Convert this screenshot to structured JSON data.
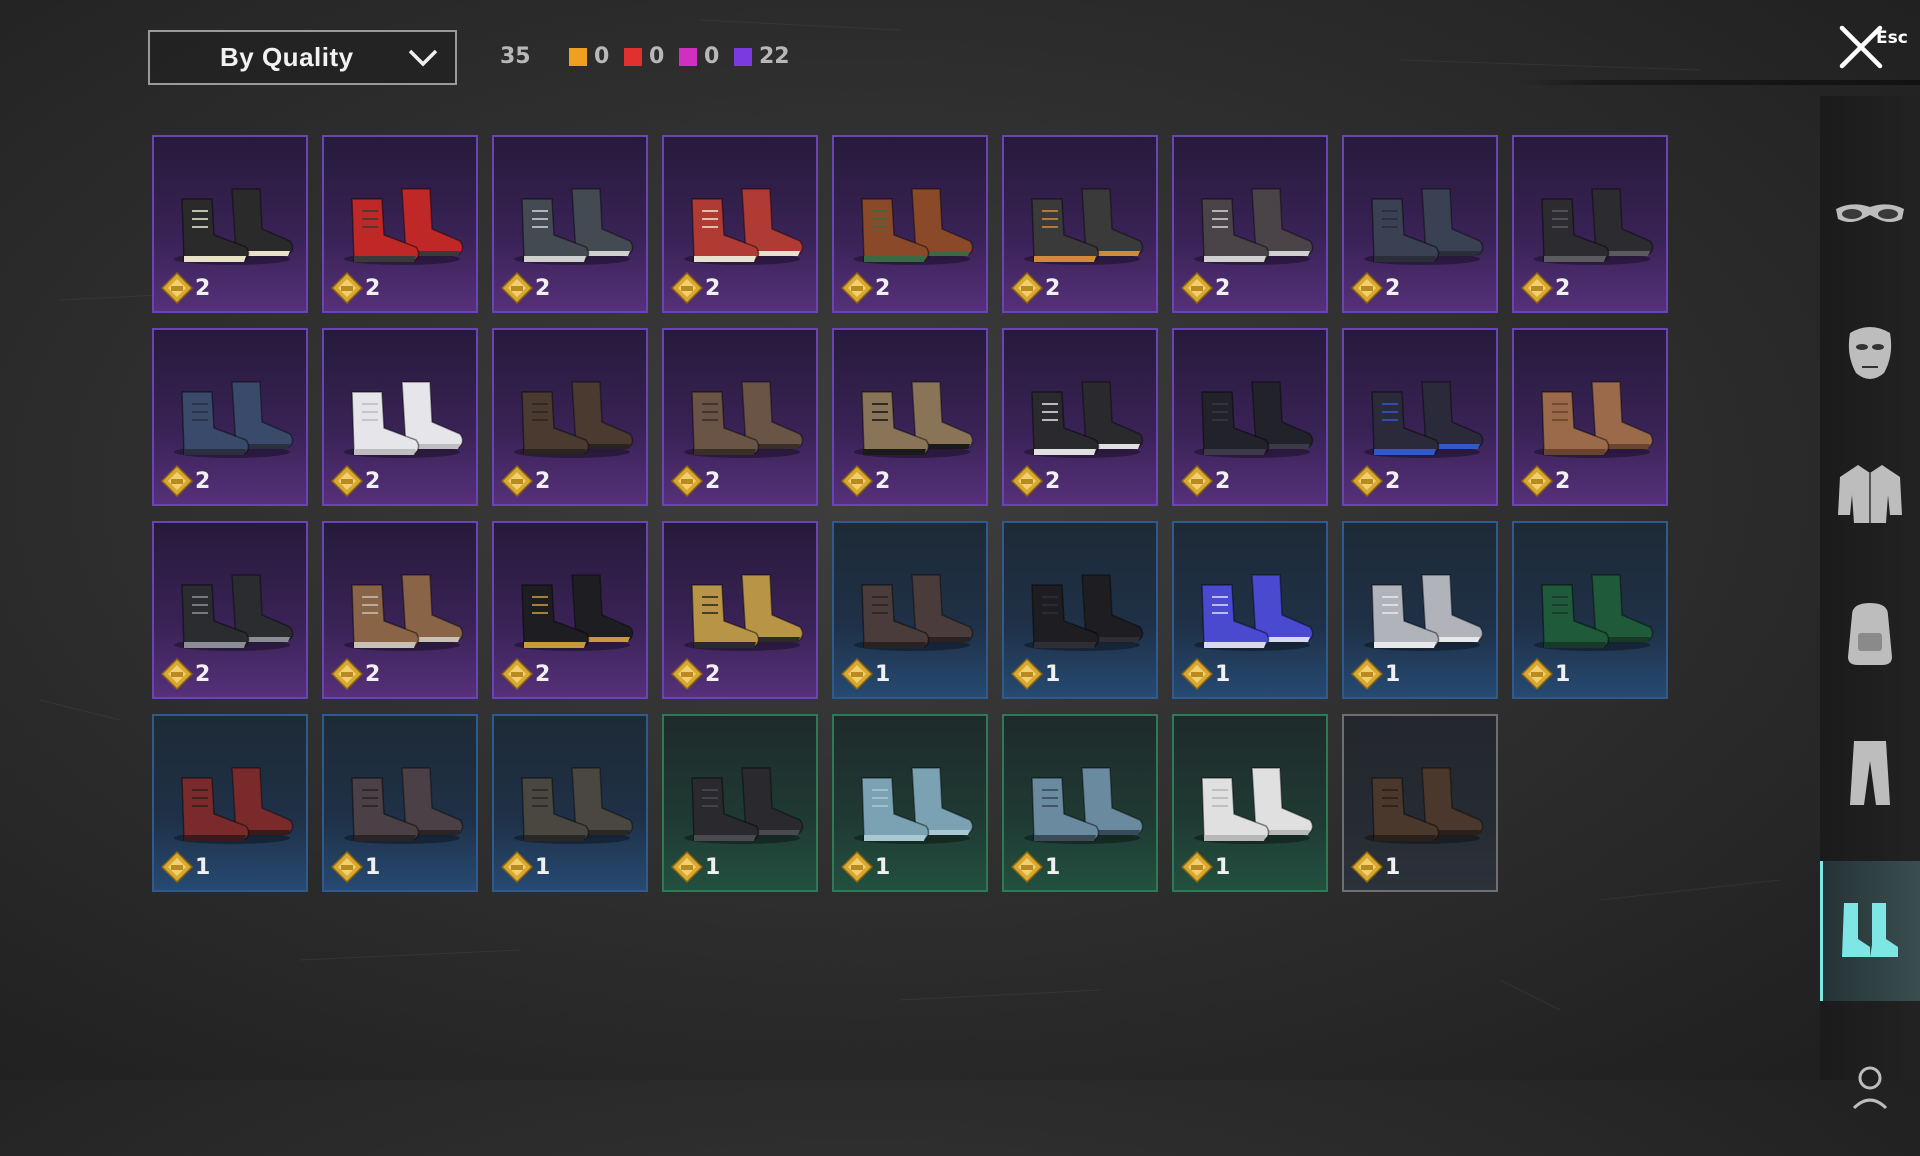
{
  "toolbar": {
    "sort_label": "By Quality",
    "total_count": "35",
    "quality_counts": [
      {
        "color": "#f0a020",
        "count": "0"
      },
      {
        "color": "#e03030",
        "count": "0"
      },
      {
        "color": "#d030c0",
        "count": "0"
      },
      {
        "color": "#7a3ae0",
        "count": "22"
      }
    ]
  },
  "close": {
    "label": "Esc"
  },
  "items": [
    {
      "quality": "purple",
      "color": "#2a2a2a",
      "accent": "#e8e0c8",
      "points": "2"
    },
    {
      "quality": "purple",
      "color": "#c02828",
      "accent": "#3a3a3a",
      "points": "2"
    },
    {
      "quality": "purple",
      "color": "#444a52",
      "accent": "#cfcfcf",
      "points": "2"
    },
    {
      "quality": "purple",
      "color": "#b03a34",
      "accent": "#e8e0d0",
      "points": "2"
    },
    {
      "quality": "purple",
      "color": "#8a4a2a",
      "accent": "#3a6a44",
      "points": "2"
    },
    {
      "quality": "purple",
      "color": "#3a3a3a",
      "accent": "#d08a3a",
      "points": "2"
    },
    {
      "quality": "purple",
      "color": "#4a4448",
      "accent": "#d0d0d0",
      "points": "2"
    },
    {
      "quality": "purple",
      "color": "#394152",
      "accent": "#2a2e38",
      "points": "2"
    },
    {
      "quality": "purple",
      "color": "#2c2c30",
      "accent": "#5a5a60",
      "points": "2"
    },
    {
      "quality": "purple",
      "color": "#3a4a6a",
      "accent": "#2a3040",
      "points": "2"
    },
    {
      "quality": "purple",
      "color": "#e6e6ea",
      "accent": "#bdbdc2",
      "points": "2"
    },
    {
      "quality": "purple",
      "color": "#4a3a30",
      "accent": "#2a2420",
      "points": "2"
    },
    {
      "quality": "purple",
      "color": "#6a5446",
      "accent": "#3a2e28",
      "points": "2"
    },
    {
      "quality": "purple",
      "color": "#8a7458",
      "accent": "#1a1a1a",
      "points": "2"
    },
    {
      "quality": "purple",
      "color": "#2a2a2e",
      "accent": "#e0e0e0",
      "points": "2"
    },
    {
      "quality": "purple",
      "color": "#22222a",
      "accent": "#3a3a48",
      "points": "2"
    },
    {
      "quality": "purple",
      "color": "#2a2a3a",
      "accent": "#2f5ac8",
      "points": "2"
    },
    {
      "quality": "purple",
      "color": "#9a6a4a",
      "accent": "#6a4430",
      "points": "2"
    },
    {
      "quality": "purple",
      "color": "#2a2c30",
      "accent": "#8a8e94",
      "points": "2"
    },
    {
      "quality": "purple",
      "color": "#8a6446",
      "accent": "#c8c0b4",
      "points": "2"
    },
    {
      "quality": "purple",
      "color": "#1e1e22",
      "accent": "#c89a3a",
      "points": "2"
    },
    {
      "quality": "purple",
      "color": "#b89446",
      "accent": "#2a2a2a",
      "points": "2"
    },
    {
      "quality": "blue",
      "color": "#4a3c3a",
      "accent": "#2a2222",
      "points": "1"
    },
    {
      "quality": "blue",
      "color": "#1e1e22",
      "accent": "#2e2e34",
      "points": "1"
    },
    {
      "quality": "blue",
      "color": "#4a4ad0",
      "accent": "#d8d8f0",
      "points": "1"
    },
    {
      "quality": "blue",
      "color": "#b0b4ba",
      "accent": "#e8e8ea",
      "points": "1"
    },
    {
      "quality": "blue",
      "color": "#1f5a3a",
      "accent": "#173a28",
      "points": "1"
    },
    {
      "quality": "blue",
      "color": "#7a2a2a",
      "accent": "#3a1a1a",
      "points": "1"
    },
    {
      "quality": "blue",
      "color": "#4a4046",
      "accent": "#2a2426",
      "points": "1"
    },
    {
      "quality": "blue",
      "color": "#4a4640",
      "accent": "#2a2824",
      "points": "1"
    },
    {
      "quality": "green",
      "color": "#2a2a2e",
      "accent": "#4a4a50",
      "points": "1"
    },
    {
      "quality": "green",
      "color": "#7aa2b2",
      "accent": "#a8c8d2",
      "points": "1"
    },
    {
      "quality": "green",
      "color": "#6a8aa0",
      "accent": "#3a4a58",
      "points": "1"
    },
    {
      "quality": "green",
      "color": "#e0e0e0",
      "accent": "#b8b8b8",
      "points": "1"
    },
    {
      "quality": "grey",
      "color": "#4a382c",
      "accent": "#2a201a",
      "points": "1"
    }
  ],
  "sidebar": {
    "items": [
      {
        "name": "goggles",
        "active": false
      },
      {
        "name": "mask",
        "active": false
      },
      {
        "name": "jacket",
        "active": false
      },
      {
        "name": "backpack",
        "active": false
      },
      {
        "name": "pants",
        "active": false
      },
      {
        "name": "shoes",
        "active": true
      },
      {
        "name": "character",
        "active": false
      }
    ],
    "active_color": "#7fe6e6"
  }
}
